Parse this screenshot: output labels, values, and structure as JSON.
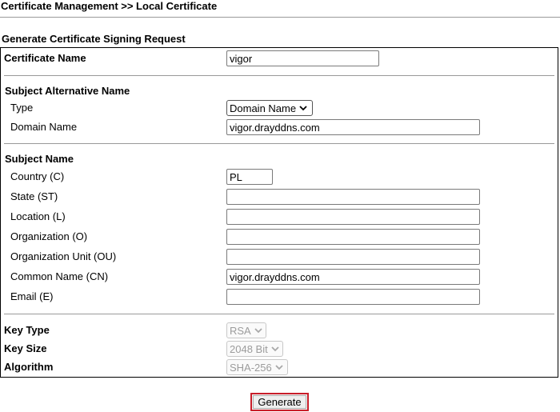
{
  "breadcrumb": "Certificate Management >> Local Certificate",
  "form_title": "Generate Certificate Signing Request",
  "certificate_name": {
    "label": "Certificate Name",
    "value": "vigor"
  },
  "san": {
    "heading": "Subject Alternative Name",
    "type_label": "Type",
    "type_value": "Domain Name",
    "domain_label": "Domain Name",
    "domain_value": "vigor.drayddns.com"
  },
  "subject": {
    "heading": "Subject Name",
    "fields": [
      {
        "label": "Country (C)",
        "value": "PL"
      },
      {
        "label": "State (ST)",
        "value": ""
      },
      {
        "label": "Location (L)",
        "value": ""
      },
      {
        "label": "Organization (O)",
        "value": ""
      },
      {
        "label": "Organization Unit (OU)",
        "value": ""
      },
      {
        "label": "Common Name (CN)",
        "value": "vigor.drayddns.com"
      },
      {
        "label": "Email (E)",
        "value": ""
      }
    ]
  },
  "key": {
    "type_label": "Key Type",
    "type_value": "RSA",
    "size_label": "Key Size",
    "size_value": "2048 Bit",
    "algo_label": "Algorithm",
    "algo_value": "SHA-256"
  },
  "generate_label": "Generate"
}
